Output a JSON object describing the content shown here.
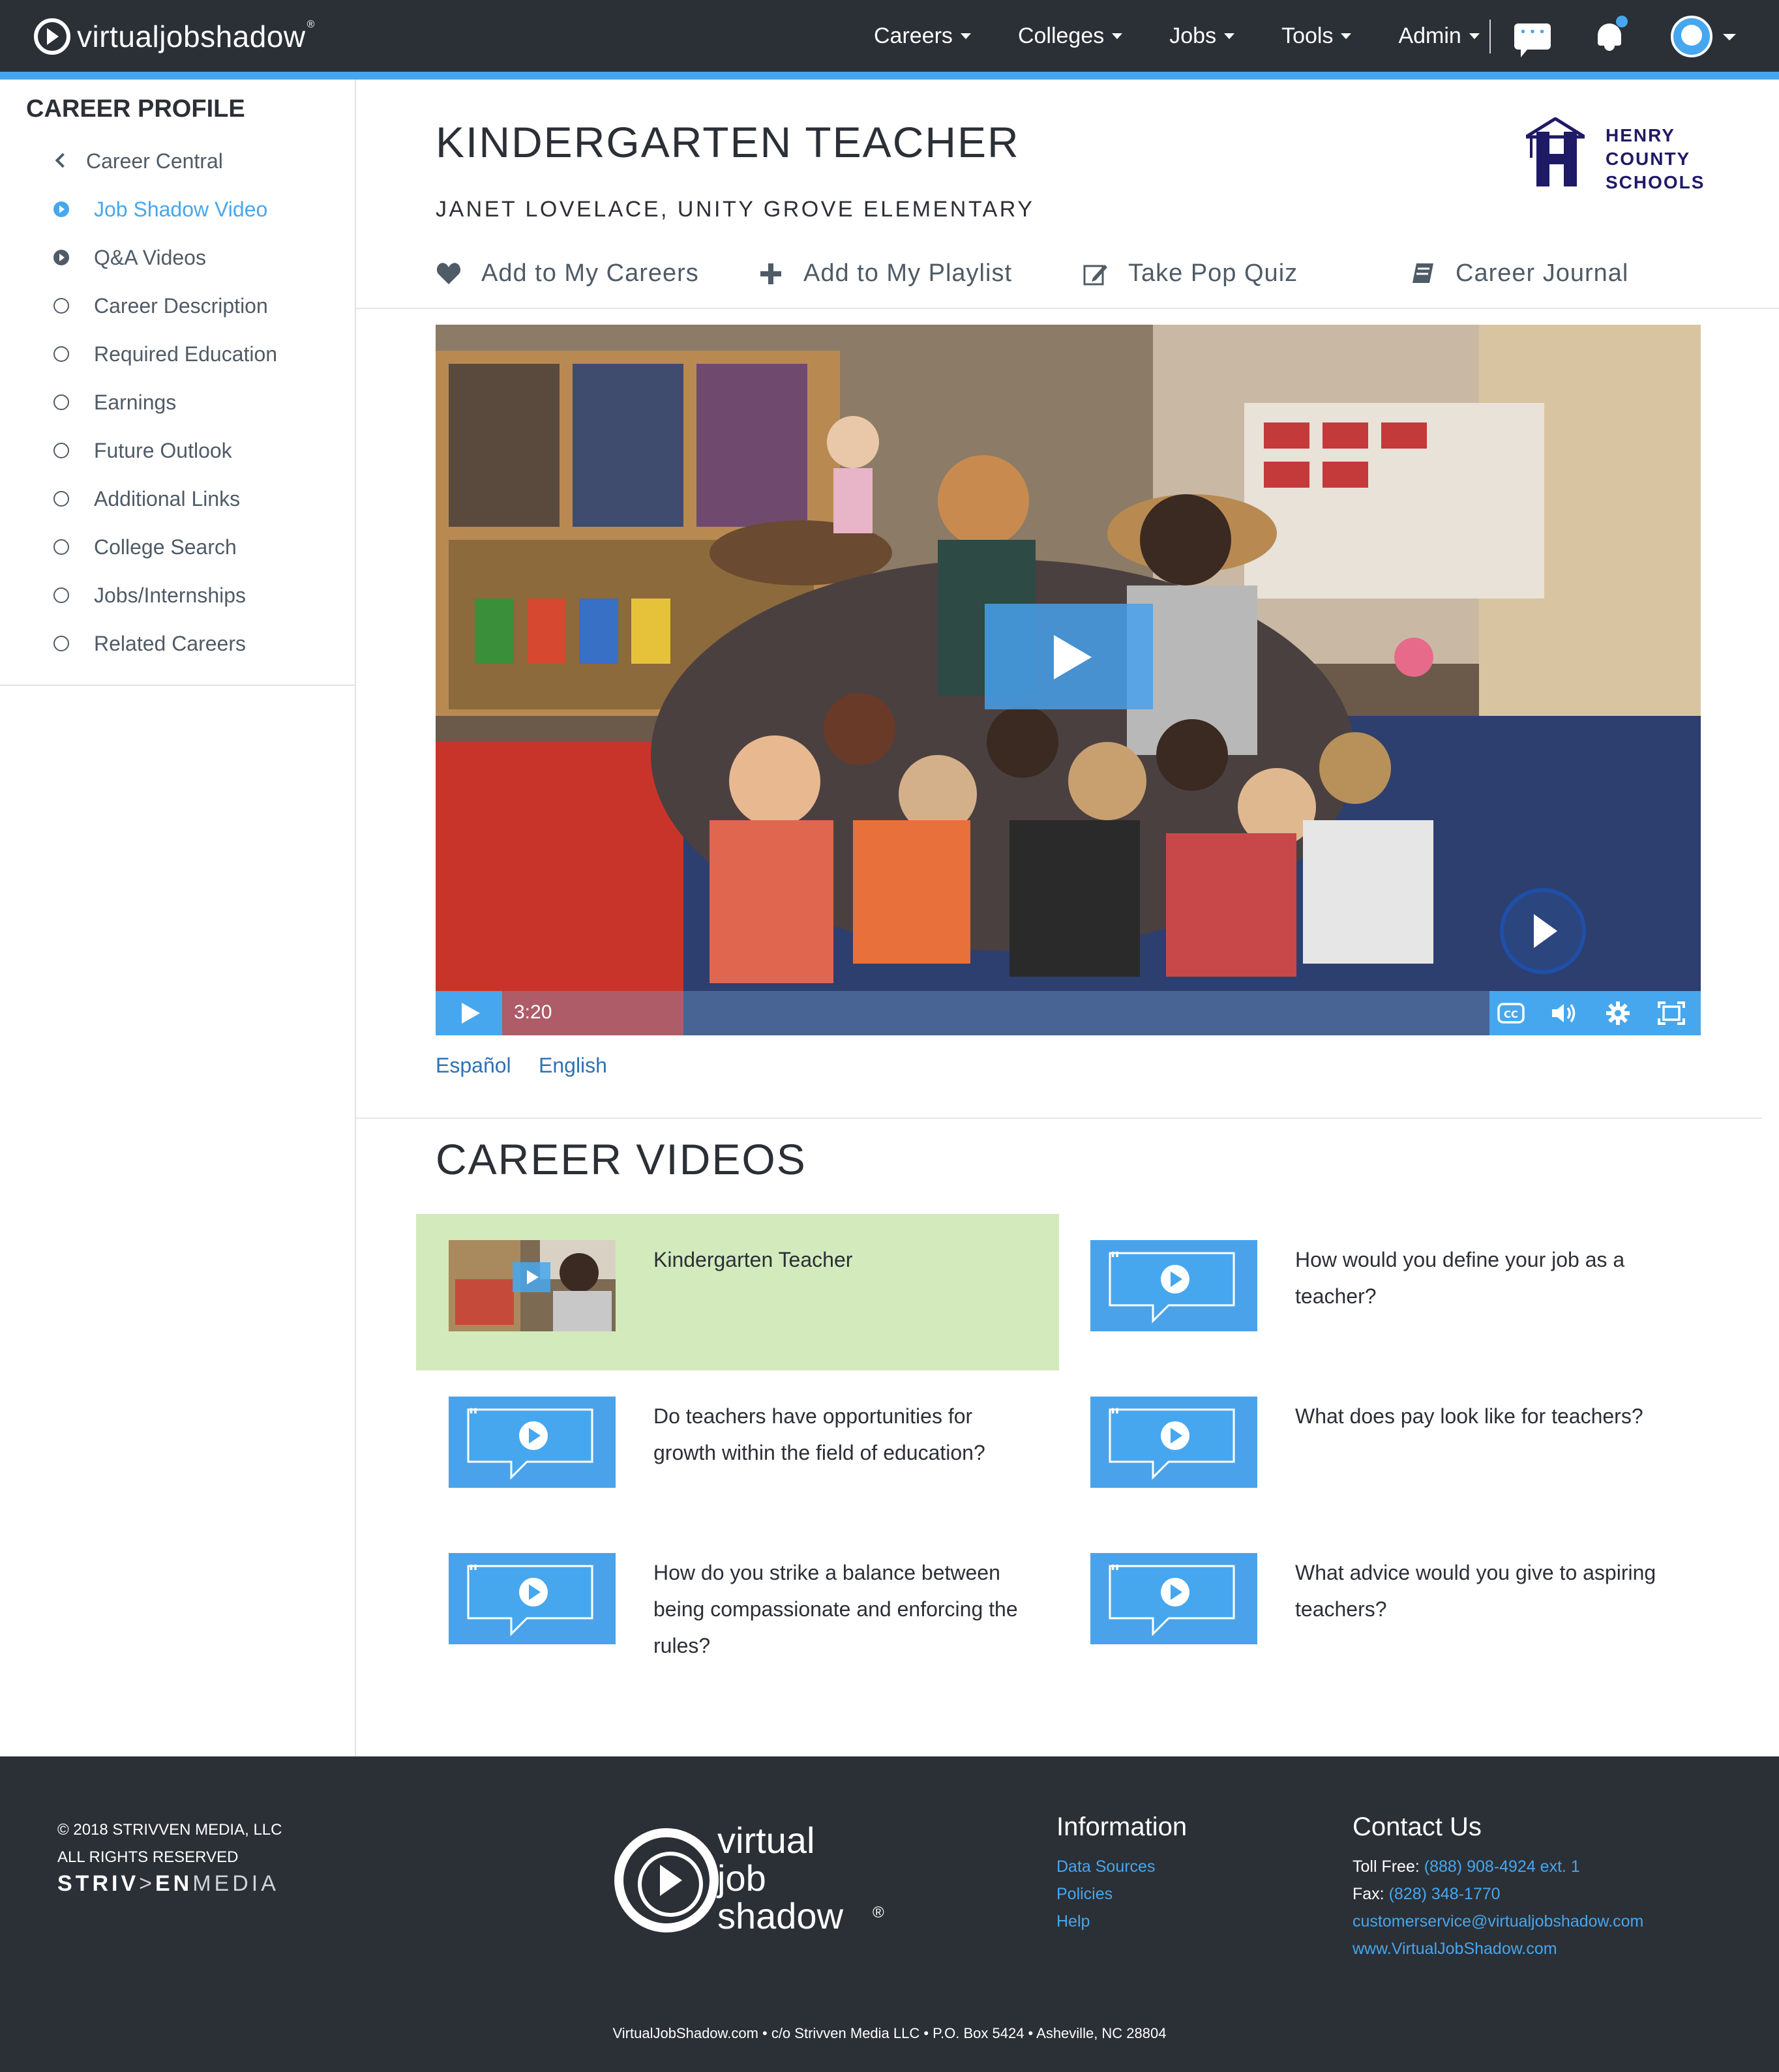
{
  "brand": {
    "name_bold": "virtualjob",
    "name_light": "shadow",
    "reg": "®"
  },
  "nav": {
    "items": [
      {
        "label": "Careers"
      },
      {
        "label": "Colleges"
      },
      {
        "label": "Jobs"
      },
      {
        "label": "Tools"
      },
      {
        "label": "Admin"
      }
    ]
  },
  "sidebar": {
    "title": "CAREER PROFILE",
    "back_label": "Career Central",
    "items": [
      {
        "label": "Job Shadow Video",
        "state": "active"
      },
      {
        "label": "Q&A Videos",
        "state": "filled"
      },
      {
        "label": "Career Description",
        "state": "empty"
      },
      {
        "label": "Required Education",
        "state": "empty"
      },
      {
        "label": "Earnings",
        "state": "empty"
      },
      {
        "label": "Future Outlook",
        "state": "empty"
      },
      {
        "label": "Additional Links",
        "state": "empty"
      },
      {
        "label": "College Search",
        "state": "empty"
      },
      {
        "label": "Jobs/Internships",
        "state": "empty"
      },
      {
        "label": "Related Careers",
        "state": "empty"
      }
    ]
  },
  "header": {
    "title": "KINDERGARTEN TEACHER",
    "subtitle": "JANET LOVELACE, UNITY GROVE ELEMENTARY",
    "logo_lines": [
      "HENRY",
      "COUNTY",
      "SCHOOLS"
    ]
  },
  "actions": {
    "add_careers": "Add to My Careers",
    "add_playlist": "Add to My Playlist",
    "pop_quiz": "Take Pop Quiz",
    "journal": "Career Journal"
  },
  "video": {
    "time": "3:20",
    "cc_label": "CC"
  },
  "languages": {
    "spanish": "Español",
    "english": "English"
  },
  "career_videos": {
    "title": "CAREER VIDEOS",
    "items": [
      {
        "label": "Kindergarten Teacher"
      },
      {
        "label": "How would you define your job as a teacher?"
      },
      {
        "label": "Do teachers have opportunities for growth within the field of education?"
      },
      {
        "label": "What does pay look like for teachers?"
      },
      {
        "label": "How do you strike a balance between being compassionate and enforcing the rules?"
      },
      {
        "label": "What advice would you give to aspiring teachers?"
      }
    ]
  },
  "footer": {
    "copy_line1": "© 2018 STRIVVEN MEDIA, LLC",
    "copy_line2": "ALL RIGHTS RESERVED",
    "strivven_a": "STRIV",
    "strivven_b": ">",
    "strivven_c": "EN",
    "strivven_d": "MEDIA",
    "logo_line1": "virtual",
    "logo_line2": "job",
    "logo_line3": "shadow",
    "logo_reg": "®",
    "info_title": "Information",
    "info_links": [
      "Data Sources",
      "Policies",
      "Help"
    ],
    "contact_title": "Contact Us",
    "toll_free_label": "Toll Free:",
    "toll_free": "(888) 908-4924 ext. 1",
    "fax_label": "Fax:",
    "fax": "(828) 348-1770",
    "email": "customerservice@virtualjobshadow.com",
    "website": "www.VirtualJobShadow.com",
    "address": "VirtualJobShadow.com  •  c/o Strivven Media LLC  •  P.O. Box 5424  •  Asheville, NC 28804"
  },
  "colors": {
    "accent": "#46a7ee",
    "nav_bg": "#2b2f36",
    "highlight": "#d3eabc",
    "link": "#2f72b3"
  }
}
